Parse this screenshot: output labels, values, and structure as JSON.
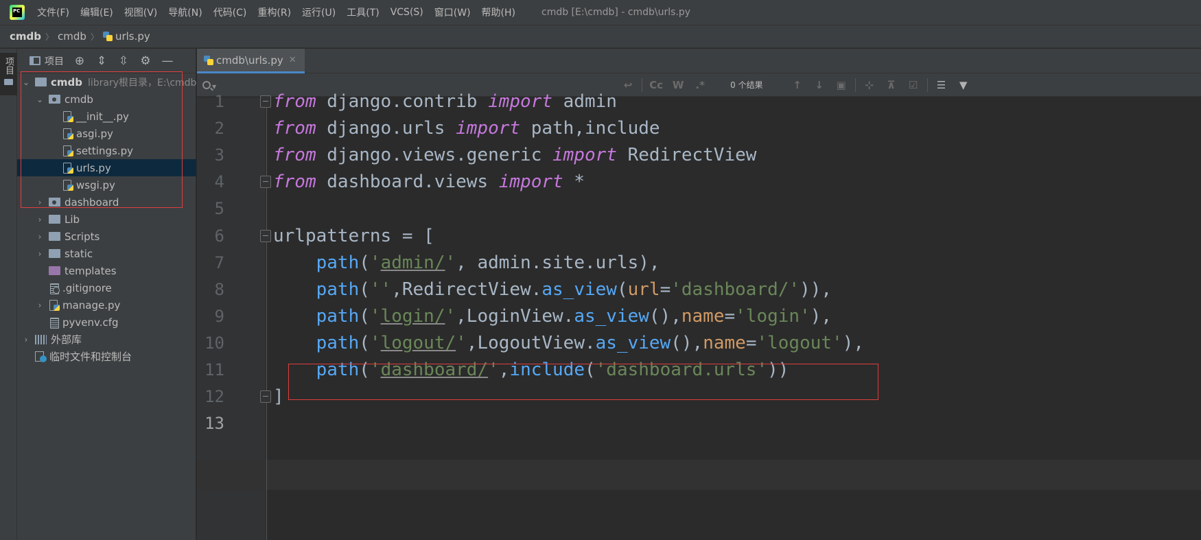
{
  "app": {
    "window_title": "cmdb [E:\\cmdb] - cmdb\\urls.py",
    "logo_text": "PC"
  },
  "menu": {
    "items": [
      "文件(F)",
      "编辑(E)",
      "视图(V)",
      "导航(N)",
      "代码(C)",
      "重构(R)",
      "运行(U)",
      "工具(T)",
      "VCS(S)",
      "窗口(W)",
      "帮助(H)"
    ]
  },
  "breadcrumb": {
    "items": [
      "cmdb",
      "cmdb",
      "urls.py"
    ]
  },
  "tool_strip": {
    "label": "项目"
  },
  "project_panel": {
    "title": "项目",
    "tree": [
      {
        "label": "cmdb",
        "hint": "library根目录，E:\\cmdb",
        "level": 0,
        "expanded": true,
        "type": "folder",
        "bold": true
      },
      {
        "label": "cmdb",
        "level": 1,
        "expanded": true,
        "type": "module"
      },
      {
        "label": "__init__.py",
        "level": 2,
        "type": "py"
      },
      {
        "label": "asgi.py",
        "level": 2,
        "type": "py"
      },
      {
        "label": "settings.py",
        "level": 2,
        "type": "py"
      },
      {
        "label": "urls.py",
        "level": 2,
        "type": "py",
        "selected": true
      },
      {
        "label": "wsgi.py",
        "level": 2,
        "type": "py"
      },
      {
        "label": "dashboard",
        "level": 1,
        "expanded": false,
        "type": "module"
      },
      {
        "label": "Lib",
        "level": 1,
        "expanded": false,
        "type": "folder"
      },
      {
        "label": "Scripts",
        "level": 1,
        "expanded": false,
        "type": "folder"
      },
      {
        "label": "static",
        "level": 1,
        "expanded": false,
        "type": "folder"
      },
      {
        "label": "templates",
        "level": 1,
        "type": "purple"
      },
      {
        "label": ".gitignore",
        "level": 1,
        "type": "gitignore"
      },
      {
        "label": "manage.py",
        "level": 1,
        "expanded": false,
        "type": "py"
      },
      {
        "label": "pyvenv.cfg",
        "level": 1,
        "type": "txt"
      },
      {
        "label": "外部库",
        "level": 0,
        "expanded": false,
        "type": "lib"
      },
      {
        "label": "临时文件和控制台",
        "level": 0,
        "type": "scratch"
      }
    ]
  },
  "editor": {
    "tab_label": "cmdb\\urls.py",
    "search": {
      "value": "",
      "match_count": "0 个结果",
      "options": [
        "Cc",
        "W",
        ".*"
      ]
    },
    "current_line": 13,
    "line_numbers": [
      "1",
      "2",
      "3",
      "4",
      "5",
      "6",
      "7",
      "8",
      "9",
      "10",
      "11",
      "12",
      "13"
    ]
  },
  "colors": {
    "keyword": "#c678dd",
    "function": "#56a8f5",
    "string": "#6a8759",
    "param": "#d19a66",
    "text": "#a9b7c6",
    "highlight_box": "#e03e3e",
    "selection": "#0d293e"
  }
}
